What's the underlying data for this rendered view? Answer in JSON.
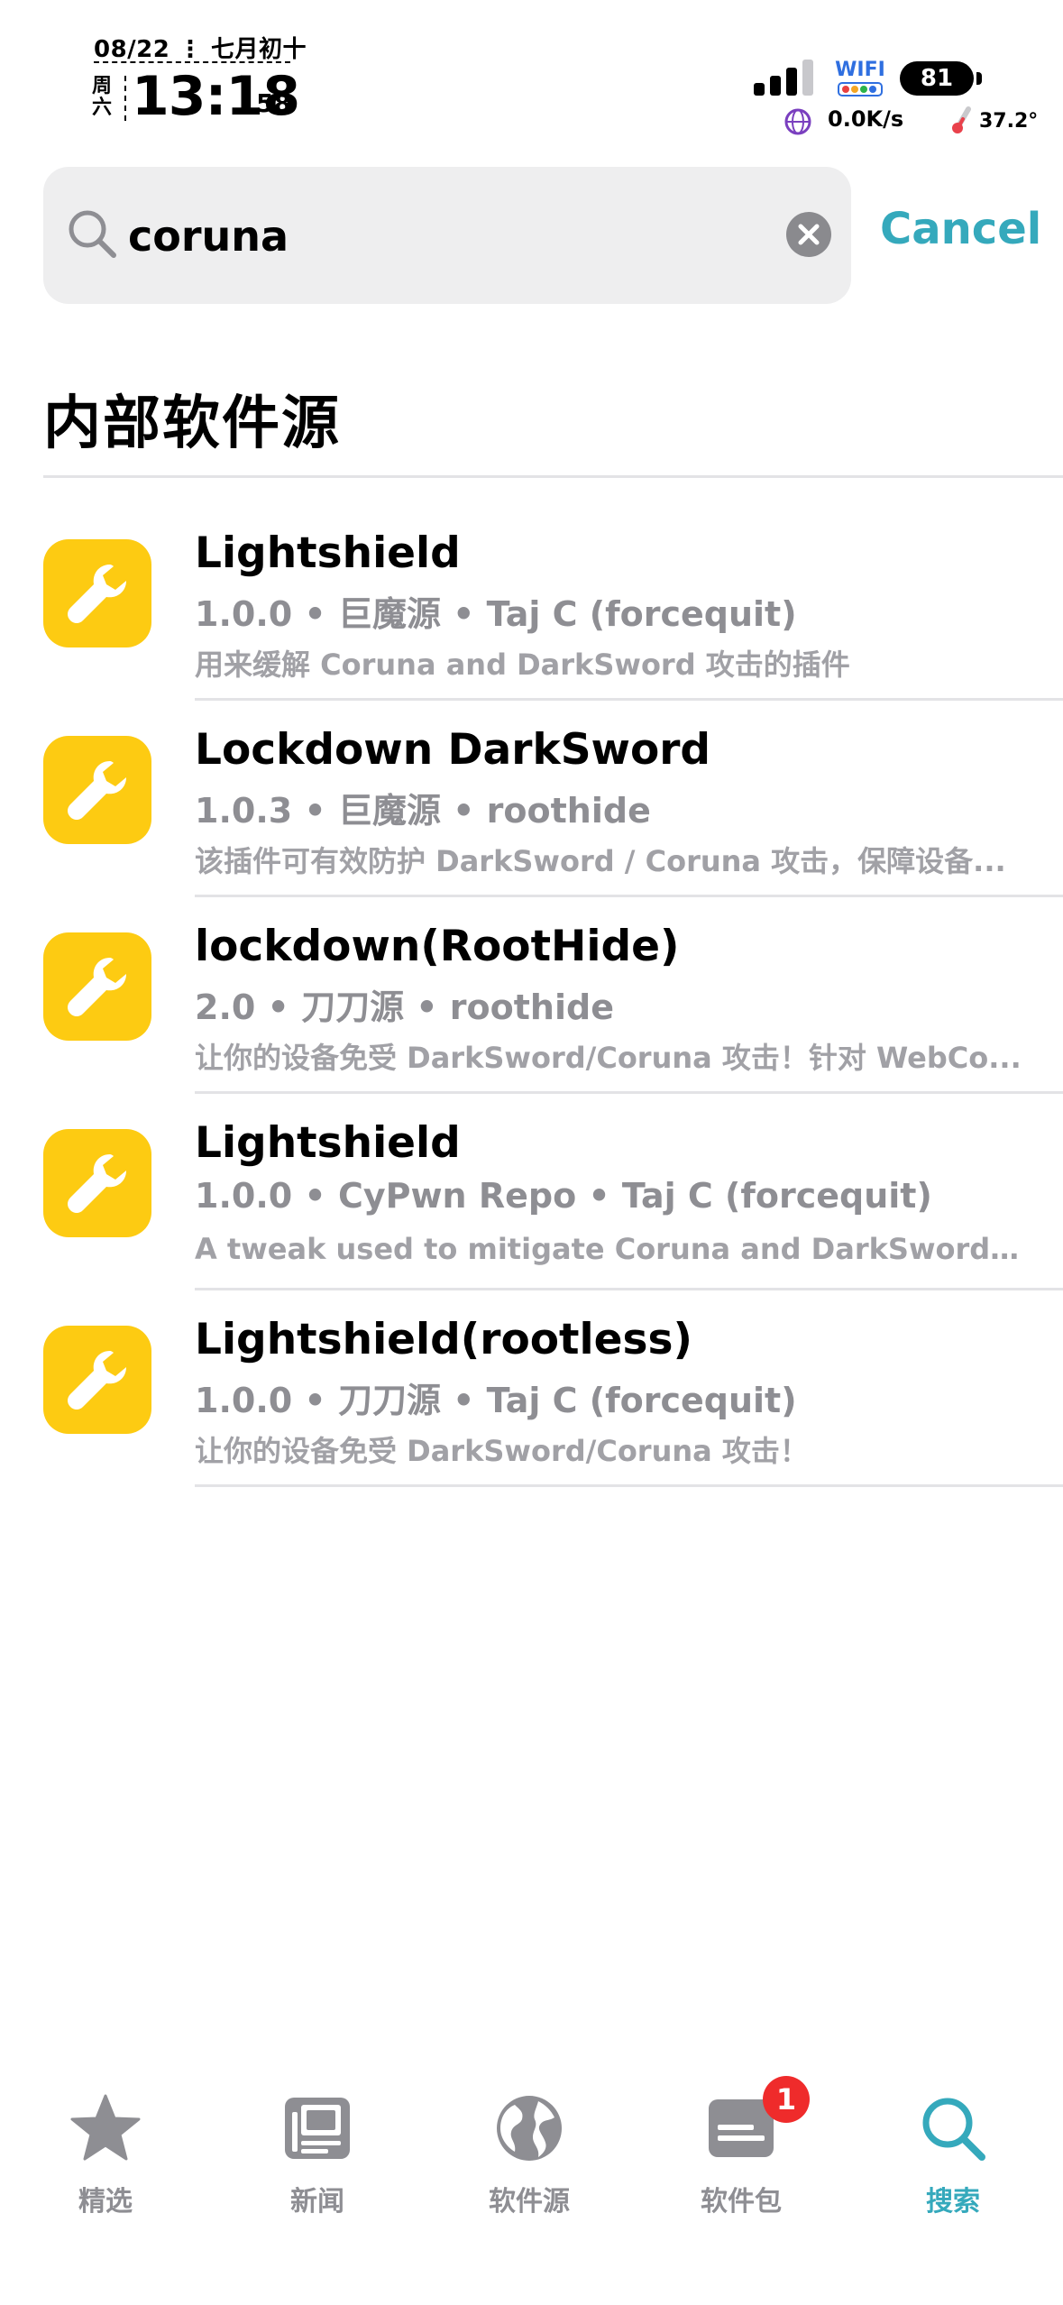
{
  "status_bar": {
    "date": "08/22 ⋮ 七月初十",
    "weekday_top": "周",
    "weekday_bottom": "六",
    "time": "13:18",
    "seconds": "58",
    "wifi_label": "WIFI",
    "battery": "81",
    "net_speed": "0.0K/s",
    "temperature": "37.2°"
  },
  "search": {
    "query": "coruna",
    "cancel_label": "Cancel"
  },
  "section": {
    "title": "内部软件源"
  },
  "results": [
    {
      "title": "Lightshield",
      "meta": "1.0.0 • 巨魔源 • Taj C (forcequit)",
      "description": "用来缓解 Coruna and DarkSword 攻击的插件",
      "icon": "wrench-icon"
    },
    {
      "title": "Lockdown DarkSword",
      "meta": "1.0.3 • 巨魔源 • roothide",
      "description": "该插件可有效防护 DarkSword / Coruna 攻击，保障设备...",
      "icon": "wrench-icon"
    },
    {
      "title": "lockdown(RootHide)",
      "meta": "2.0 • 刀刀源 • roothide",
      "description": "让你的设备免受 DarkSword/Coruna 攻击！针对 WebCo...",
      "icon": "wrench-icon"
    },
    {
      "title": "Lightshield",
      "meta": "1.0.0 • CyPwn Repo • Taj C (forcequit)",
      "description": "A tweak used to mitigate Coruna and DarkSword attack...",
      "icon": "wrench-icon"
    },
    {
      "title": "Lightshield(rootless)",
      "meta": "1.0.0 • 刀刀源 • Taj C (forcequit)",
      "description": "让你的设备免受 DarkSword/Coruna 攻击！",
      "icon": "wrench-icon"
    }
  ],
  "tabbar": {
    "tabs": [
      {
        "label": "精选",
        "icon": "star-icon"
      },
      {
        "label": "新闻",
        "icon": "newspaper-icon"
      },
      {
        "label": "软件源",
        "icon": "globe-icon"
      },
      {
        "label": "软件包",
        "icon": "package-icon",
        "badge": "1"
      },
      {
        "label": "搜索",
        "icon": "search-icon",
        "active": true
      }
    ]
  },
  "colors": {
    "accent": "#35a9bc",
    "icon_bg": "#fdcb12",
    "badge": "#ef2b2b",
    "secondary_text": "#8e8e93"
  }
}
